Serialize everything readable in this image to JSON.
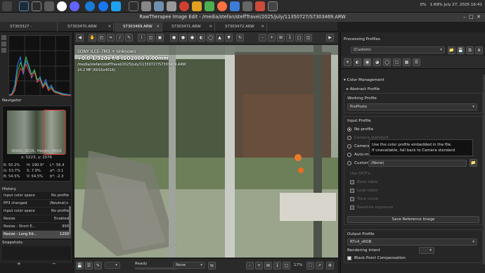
{
  "taskbar": {
    "status": "0%   1:69% July 27, 2025 16:41"
  },
  "window": {
    "title": "RawTherapee Image Edit - /media/stefan/steffTravel/2025/july/11350727/S7303469.ARW"
  },
  "tabs": [
    {
      "label": "S7303327 - S7303335.jpg"
    },
    {
      "label": "S7303470.ARW"
    },
    {
      "label": "S7303469.ARW"
    },
    {
      "label": "S7303471.ARW"
    },
    {
      "label": "S7303472.ARW"
    }
  ],
  "navigator": {
    "title": "Navigator",
    "size": "Width: 6016, Height: 4016",
    "coords": "x: 5223, y: 2076",
    "r": "R:  50.2%",
    "h": "H:  190.9°",
    "l": "L*:  56.4",
    "g": "G:  53.7%",
    "s": "S:  7.9%",
    "a": "a*:  -3.1",
    "b": "B:  54.5%",
    "v": "V:  54.5%",
    "bb": "b*:  -2.3"
  },
  "history": {
    "title": "History",
    "rows": [
      {
        "name": "Input color space",
        "value": "No profile"
      },
      {
        "name": "PP3 changed",
        "value": "(Neutral)+"
      },
      {
        "name": "Input color space",
        "value": "No profile"
      },
      {
        "name": "Resize",
        "value": "Enabled"
      },
      {
        "name": "Resize - Short E...",
        "value": "900"
      },
      {
        "name": "Resize - Long Ed...",
        "value": "1200"
      }
    ]
  },
  "snapshots": {
    "title": "Snapshots",
    "add": "+",
    "remove": "−"
  },
  "photo_info": {
    "camera": "SONY ILCE-7M3 + Unknown",
    "exposure": "+0.0  1/320s  f/8  ISO2000  0.00mm",
    "path": "/media/stefan/steffTravel/2025/july/11350727/S7303469.ARW",
    "mp": "24.2 MP (6016x4016)"
  },
  "statusbar": {
    "ready": "Ready",
    "combo": "None",
    "zoom": "17%"
  },
  "right": {
    "profiles_title": "Processing Profiles",
    "profile_value": "(Custom)",
    "section_title": "Color Management",
    "abstract_profile": "Abstract Profile",
    "working_profile_label": "Working Profile",
    "working_profile_value": "ProPhoto",
    "input_profile_label": "Input Profile",
    "radio_no_profile": "No profile",
    "radio_camera_standard": "Camera standard",
    "radio_camera_sp": "Camera SP",
    "radio_auto": "Auto-matched",
    "radio_custom": "Custom",
    "custom_value": "(None)",
    "tooltip_line1": "Use the color profile embedded in the file.",
    "tooltip_line2": "If unavailable, fall back to Camera standard",
    "disabled_1": "Use DCP's...",
    "disabled_2": "Base table",
    "disabled_3": "Look table",
    "disabled_4": "Tone curve",
    "disabled_5": "Baseline exposure",
    "save_ref": "Save Reference Image",
    "output_profile_label": "Output Profile",
    "output_profile_value": "RTv4_sRGB",
    "rendering_intent": "Rendering Intent",
    "bpc": "Black Point Compensation"
  }
}
